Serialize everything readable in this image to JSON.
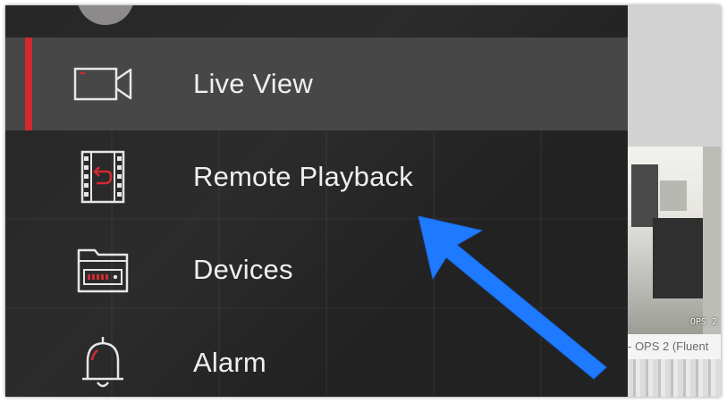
{
  "menu": {
    "items": [
      {
        "label": "Live View",
        "icon": "video-camera-icon",
        "active": true
      },
      {
        "label": "Remote Playback",
        "icon": "film-playback-icon",
        "active": false
      },
      {
        "label": "Devices",
        "icon": "dvr-folder-icon",
        "active": false
      },
      {
        "label": "Alarm",
        "icon": "bell-icon",
        "active": false
      }
    ]
  },
  "camera_panel": {
    "thumbnail_stamp": "OPS 2",
    "caption": " - OPS 2 (Fluent"
  },
  "colors": {
    "active_indicator": "#d22a2f",
    "icon_accent": "#d22a2f",
    "annotation_arrow": "#1e7bff",
    "drawer_background": "#232323",
    "active_row_background": "#474747"
  }
}
